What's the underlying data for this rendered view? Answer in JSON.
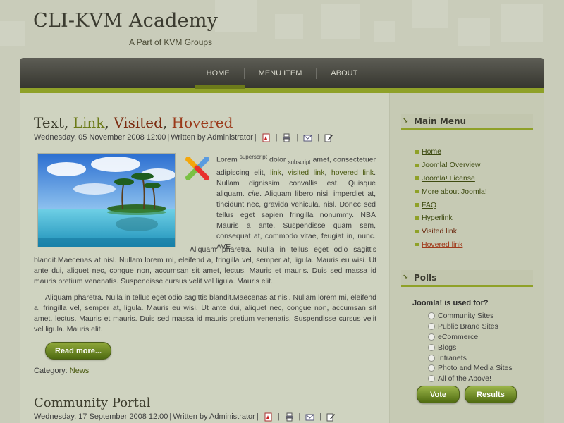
{
  "site": {
    "title": "CLI-KVM Academy",
    "subtitle": "A Part of KVM Groups"
  },
  "nav": {
    "items": [
      {
        "label": "HOME",
        "active": true
      },
      {
        "label": "MENU ITEM",
        "active": false
      },
      {
        "label": "ABOUT",
        "active": false
      }
    ]
  },
  "article1": {
    "title_parts": {
      "text": "Text",
      "comma1": ", ",
      "link": "Link",
      "comma2": ", ",
      "visited": "Visited",
      "comma3": ", ",
      "hovered": "Hovered"
    },
    "meta": {
      "date": "Wednesday, 05 November 2008 12:00",
      "separator": "|",
      "written_by": "Written by Administrator"
    },
    "para1": {
      "lorem": "Lorem",
      "superscript": "superscript",
      "dolor": "dolor",
      "subscript": "subscript",
      "amet": "amet, consectetuer adipiscing elit,",
      "link": "link",
      "visited_link": "visited link",
      "hovered_link": "hovered link",
      "rest": ". Nullam dignissim convallis est. Quisque aliquam.",
      "cite": "cite",
      "tail": ". Aliquam libero nisi, imperdiet at, tincidunt nec, gravida vehicula, nisl. Donec sed tellus eget sapien fringilla nonummy. NBA Mauris a ante. Suspendisse quam sem, consequat at, commodo vitae, feugiat in, nunc. AVE"
    },
    "para2": "Aliquam pharetra. Nulla in tellus eget odio sagittis blandit.Maecenas at nisl. Nullam lorem mi, eleifend a, fringilla vel, semper at, ligula. Mauris eu wisi. Ut ante dui, aliquet nec, congue non, accumsan sit amet, lectus. Mauris et mauris. Duis sed massa id mauris pretium venenatis. Suspendisse cursus velit vel ligula. Mauris elit.",
    "para3": "Aliquam pharetra. Nulla in tellus eget odio sagittis blandit.Maecenas at nisl. Nullam lorem mi, eleifend a, fringilla vel, semper at, ligula. Mauris eu wisi. Ut ante dui, aliquet nec, congue non, accumsan sit amet, lectus. Mauris et mauris. Duis sed massa id mauris pretium venenatis. Suspendisse cursus velit vel ligula. Mauris elit.",
    "readmore_label": "Read more...",
    "category_label": "Category:",
    "category_value": "News"
  },
  "article2": {
    "title": "Community Portal",
    "meta": {
      "date": "Wednesday, 17 September 2008 12:00",
      "separator": "|",
      "written_by": "Written by Administrator"
    }
  },
  "sidebar": {
    "main_menu": {
      "title": "Main Menu",
      "items": [
        {
          "label": "Home",
          "style": "link"
        },
        {
          "label": "Joomla! Overview",
          "style": "link"
        },
        {
          "label": "Joomla! License",
          "style": "link"
        },
        {
          "label": "More about Joomla!",
          "style": "link"
        },
        {
          "label": "FAQ",
          "style": "link"
        },
        {
          "label": "Hyperlink",
          "style": "link"
        },
        {
          "label": "Visited link",
          "style": "visited"
        },
        {
          "label": "Hovered link",
          "style": "hovered"
        }
      ]
    },
    "polls": {
      "title": "Polls",
      "question": "Joomla! is used for?",
      "options": [
        "Community Sites",
        "Public Brand Sites",
        "eCommerce",
        "Blogs",
        "Intranets",
        "Photo and Media Sites",
        "All of the Above!"
      ],
      "vote_label": "Vote",
      "results_label": "Results"
    }
  },
  "colors": {
    "accent_green": "#8fa128",
    "nav_dark": "#3f3f38",
    "link_green": "#6b7a17",
    "visited_brown": "#7b2b10"
  },
  "icons": [
    "pdf-icon",
    "print-icon",
    "email-icon",
    "edit-icon",
    "arrow-icon",
    "joomla-logo-icon"
  ]
}
